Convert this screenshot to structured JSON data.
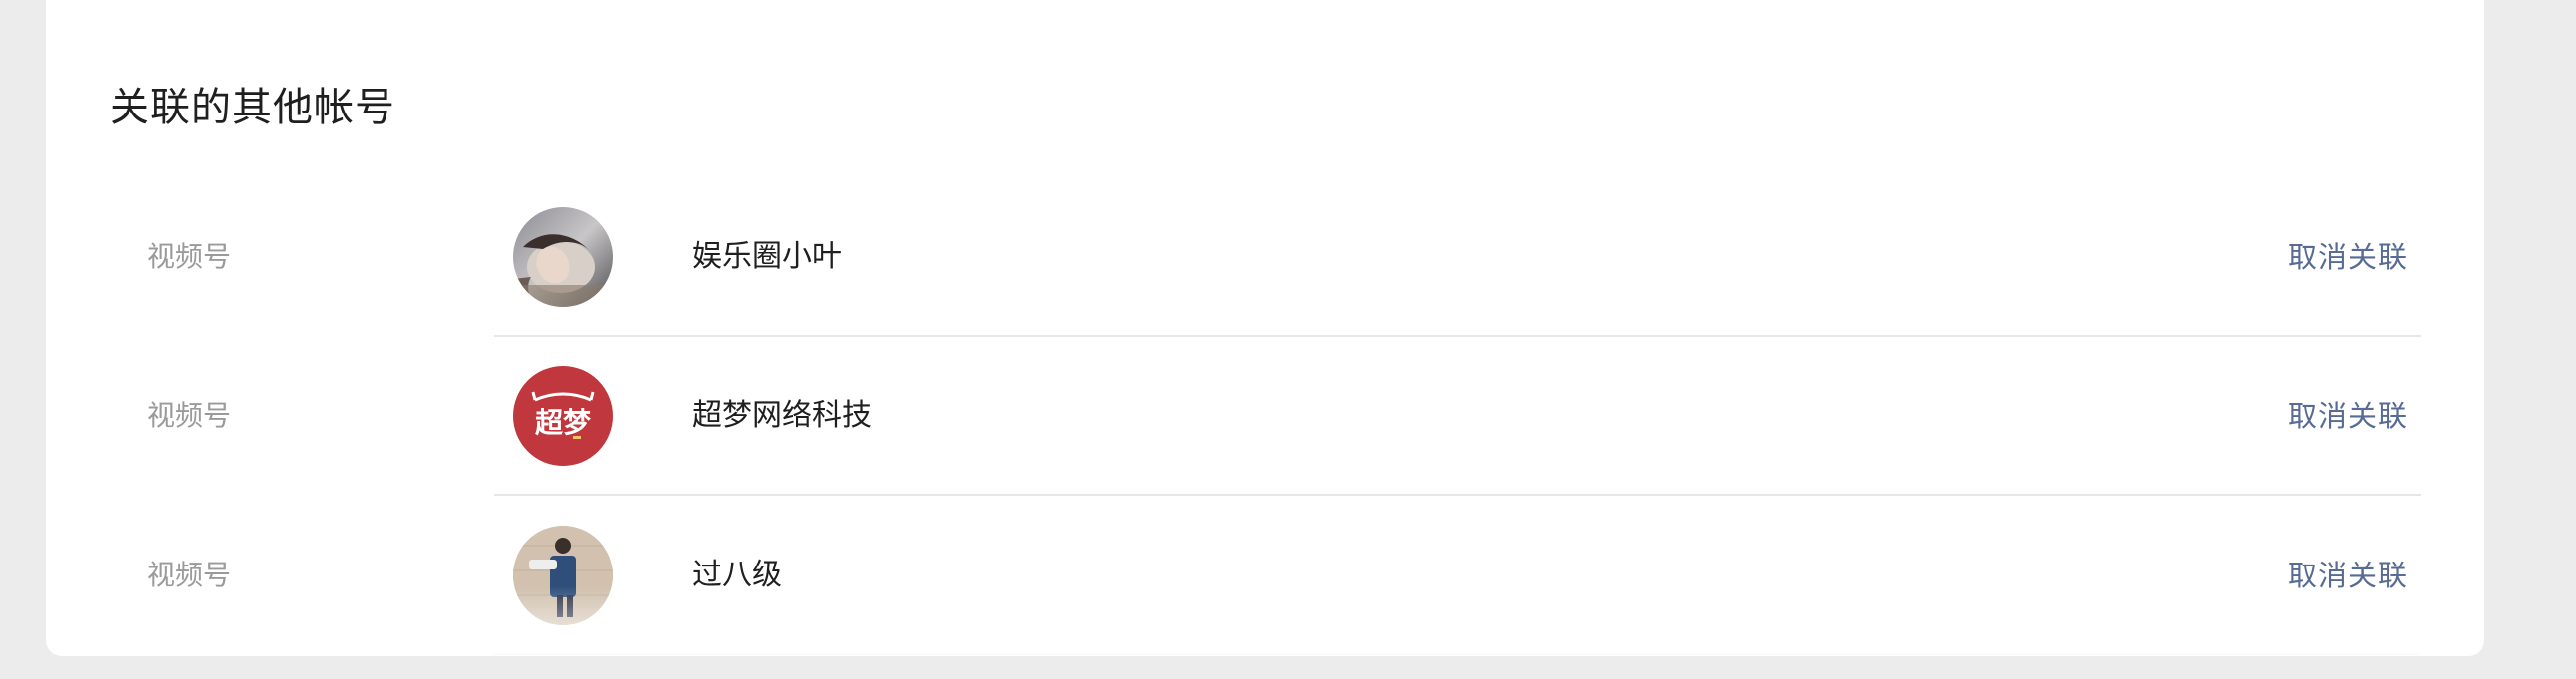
{
  "section": {
    "title": "关联的其他帐号"
  },
  "accounts": [
    {
      "type": "视频号",
      "name": "娱乐圈小叶",
      "action": "取消关联",
      "avatar_icon": "portrait-photo-icon"
    },
    {
      "type": "视频号",
      "name": "超梦网络科技",
      "action": "取消关联",
      "avatar_icon": "chaomeng-logo-icon",
      "avatar_text": "超梦",
      "avatar_color": "#c0373d"
    },
    {
      "type": "视频号",
      "name": "过八级",
      "action": "取消关联",
      "avatar_icon": "child-photo-icon"
    }
  ],
  "colors": {
    "page_background": "#ececec",
    "card_background": "#ffffff",
    "link": "#576b95",
    "label": "#9a9a9a",
    "text": "#1f1f1f"
  }
}
